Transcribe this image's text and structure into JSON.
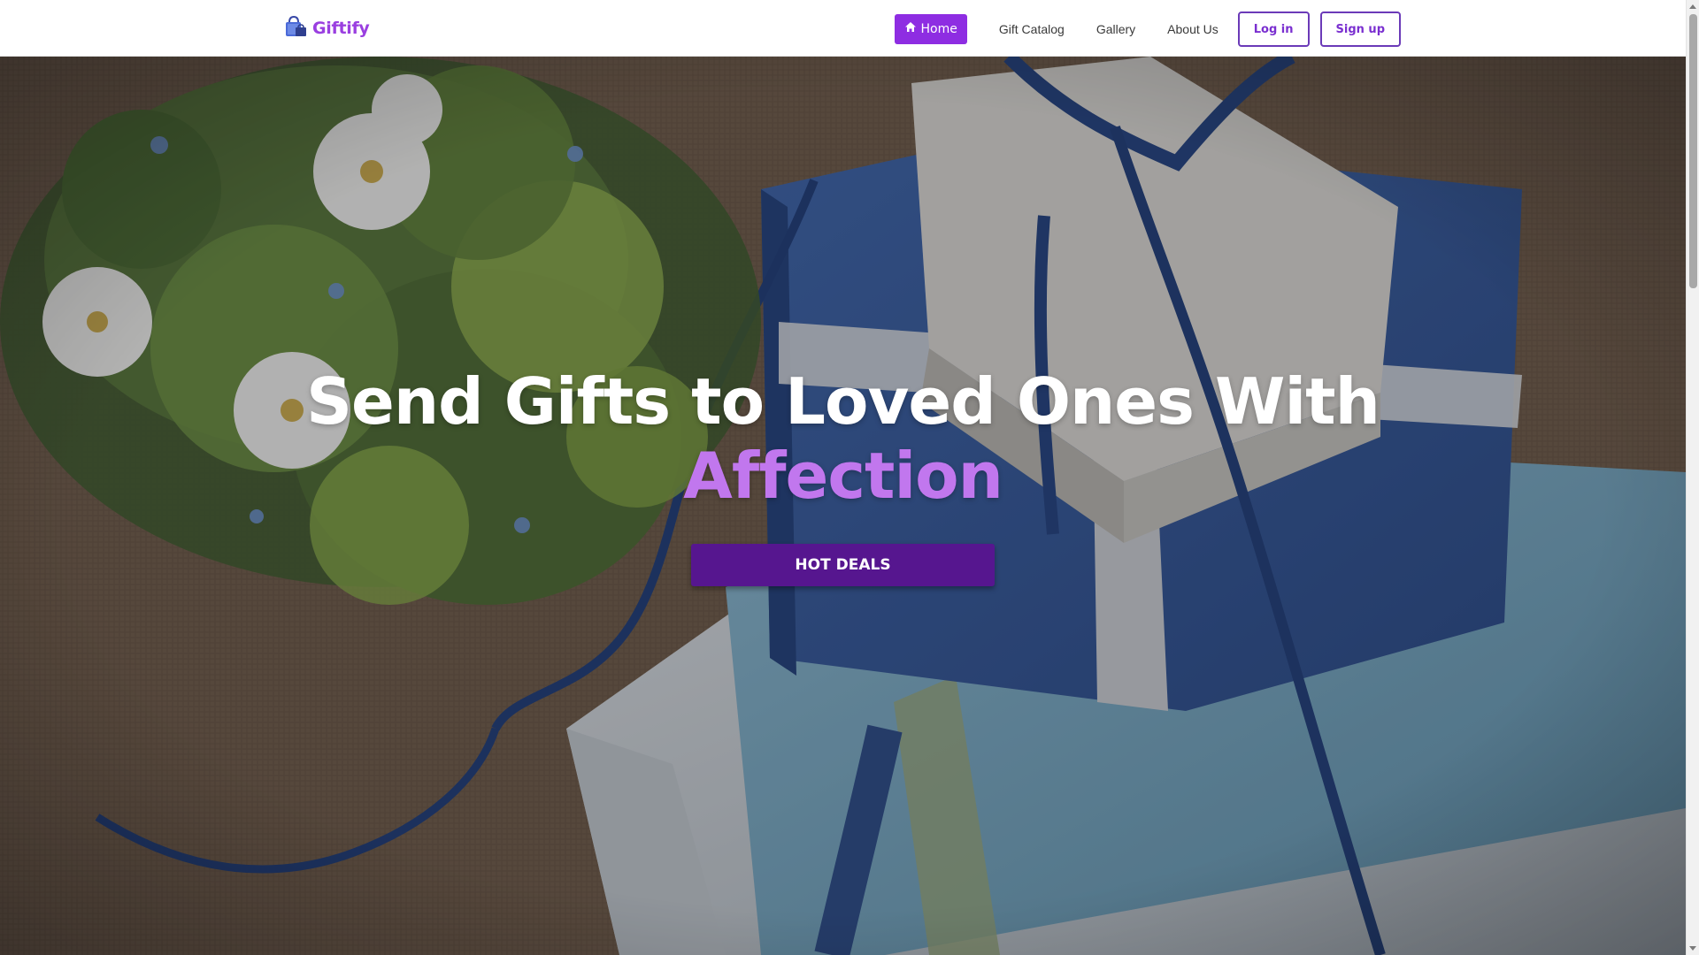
{
  "brand": {
    "name": "Giftify",
    "icon": "shopping-bag-icon"
  },
  "nav": {
    "home": "Home",
    "catalog": "Gift Catalog",
    "gallery": "Gallery",
    "about": "About Us",
    "login": "Log in",
    "signup": "Sign up"
  },
  "hero": {
    "title_line1": "Send Gifts to Loved Ones With",
    "title_accent": "Affection",
    "cta": "HOT DEALS"
  },
  "colors": {
    "accent": "#8e2de2",
    "accent_text": "#c177ee",
    "cta_bg": "#56168f",
    "brand": "#9a3fe0"
  }
}
